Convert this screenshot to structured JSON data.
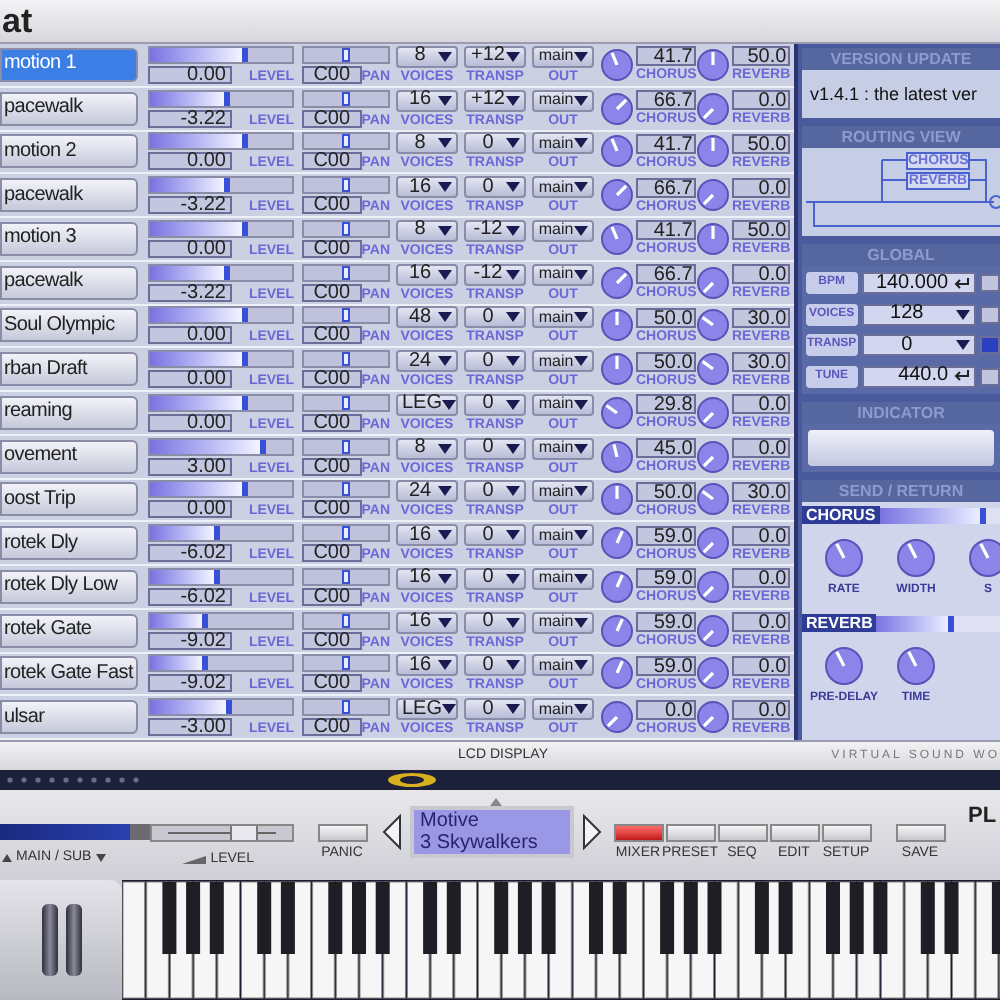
{
  "window": {
    "title": "at"
  },
  "channels": [
    {
      "name": "motion 1",
      "selected": true,
      "volume": {
        "reading": "0.00",
        "level": 0.69
      },
      "pan": {
        "reading": "C00",
        "level": 0.5
      },
      "voices": "8",
      "transp": "+12",
      "out": "main",
      "chorus": {
        "reading": "41.7"
      },
      "reverb": {
        "reading": "50.0"
      },
      "labels": [
        "LEVEL",
        "PAN",
        "VOICES",
        "TRANSP",
        "OUT",
        "CHORUS",
        "REVERB"
      ]
    },
    {
      "name": "pacewalk",
      "selected": false,
      "volume": {
        "reading": "-3.22",
        "level": 0.56
      },
      "pan": {
        "reading": "C00",
        "level": 0.5
      },
      "voices": "16",
      "transp": "+12",
      "out": "main",
      "chorus": {
        "reading": "66.7"
      },
      "reverb": {
        "reading": "0.0"
      },
      "labels": [
        "LEVEL",
        "PAN",
        "VOICES",
        "TRANSP",
        "OUT",
        "CHORUS",
        "REVERB"
      ]
    },
    {
      "name": "motion 2",
      "selected": false,
      "volume": {
        "reading": "0.00",
        "level": 0.69
      },
      "pan": {
        "reading": "C00",
        "level": 0.5
      },
      "voices": "8",
      "transp": "0",
      "out": "main",
      "chorus": {
        "reading": "41.7"
      },
      "reverb": {
        "reading": "50.0"
      },
      "labels": [
        "LEVEL",
        "PAN",
        "VOICES",
        "TRANSP",
        "OUT",
        "CHORUS",
        "REVERB"
      ]
    },
    {
      "name": "pacewalk",
      "selected": false,
      "volume": {
        "reading": "-3.22",
        "level": 0.56
      },
      "pan": {
        "reading": "C00",
        "level": 0.5
      },
      "voices": "16",
      "transp": "0",
      "out": "main",
      "chorus": {
        "reading": "66.7"
      },
      "reverb": {
        "reading": "0.0"
      },
      "labels": [
        "LEVEL",
        "PAN",
        "VOICES",
        "TRANSP",
        "OUT",
        "CHORUS",
        "REVERB"
      ]
    },
    {
      "name": "motion 3",
      "selected": false,
      "volume": {
        "reading": "0.00",
        "level": 0.69
      },
      "pan": {
        "reading": "C00",
        "level": 0.5
      },
      "voices": "8",
      "transp": "-12",
      "out": "main",
      "chorus": {
        "reading": "41.7"
      },
      "reverb": {
        "reading": "50.0"
      },
      "labels": [
        "LEVEL",
        "PAN",
        "VOICES",
        "TRANSP",
        "OUT",
        "CHORUS",
        "REVERB"
      ]
    },
    {
      "name": "pacewalk",
      "selected": false,
      "volume": {
        "reading": "-3.22",
        "level": 0.56
      },
      "pan": {
        "reading": "C00",
        "level": 0.5
      },
      "voices": "16",
      "transp": "-12",
      "out": "main",
      "chorus": {
        "reading": "66.7"
      },
      "reverb": {
        "reading": "0.0"
      },
      "labels": [
        "LEVEL",
        "PAN",
        "VOICES",
        "TRANSP",
        "OUT",
        "CHORUS",
        "REVERB"
      ]
    },
    {
      "name": "Soul Olympic",
      "selected": false,
      "volume": {
        "reading": "0.00",
        "level": 0.69
      },
      "pan": {
        "reading": "C00",
        "level": 0.5
      },
      "voices": "48",
      "transp": "0",
      "out": "main",
      "chorus": {
        "reading": "50.0"
      },
      "reverb": {
        "reading": "30.0"
      },
      "labels": [
        "LEVEL",
        "PAN",
        "VOICES",
        "TRANSP",
        "OUT",
        "CHORUS",
        "REVERB"
      ]
    },
    {
      "name": "rban Draft",
      "selected": false,
      "volume": {
        "reading": "0.00",
        "level": 0.69
      },
      "pan": {
        "reading": "C00",
        "level": 0.5
      },
      "voices": "24",
      "transp": "0",
      "out": "main",
      "chorus": {
        "reading": "50.0"
      },
      "reverb": {
        "reading": "30.0"
      },
      "labels": [
        "LEVEL",
        "PAN",
        "VOICES",
        "TRANSP",
        "OUT",
        "CHORUS",
        "REVERB"
      ]
    },
    {
      "name": "reaming",
      "selected": false,
      "volume": {
        "reading": "0.00",
        "level": 0.69
      },
      "pan": {
        "reading": "C00",
        "level": 0.5
      },
      "voices": "LEG",
      "transp": "0",
      "out": "main",
      "chorus": {
        "reading": "29.8"
      },
      "reverb": {
        "reading": "0.0"
      },
      "labels": [
        "LEVEL",
        "PAN",
        "VOICES",
        "TRANSP",
        "OUT",
        "CHORUS",
        "REVERB"
      ]
    },
    {
      "name": "ovement",
      "selected": false,
      "volume": {
        "reading": "3.00",
        "level": 0.82
      },
      "pan": {
        "reading": "C00",
        "level": 0.5
      },
      "voices": "8",
      "transp": "0",
      "out": "main",
      "chorus": {
        "reading": "45.0"
      },
      "reverb": {
        "reading": "0.0"
      },
      "labels": [
        "LEVEL",
        "PAN",
        "VOICES",
        "TRANSP",
        "OUT",
        "CHORUS",
        "REVERB"
      ]
    },
    {
      "name": "oost Trip",
      "selected": false,
      "volume": {
        "reading": "0.00",
        "level": 0.69
      },
      "pan": {
        "reading": "C00",
        "level": 0.5
      },
      "voices": "24",
      "transp": "0",
      "out": "main",
      "chorus": {
        "reading": "50.0"
      },
      "reverb": {
        "reading": "30.0"
      },
      "labels": [
        "LEVEL",
        "PAN",
        "VOICES",
        "TRANSP",
        "OUT",
        "CHORUS",
        "REVERB"
      ]
    },
    {
      "name": "rotek Dly",
      "selected": false,
      "volume": {
        "reading": "-6.02",
        "level": 0.49
      },
      "pan": {
        "reading": "C00",
        "level": 0.5
      },
      "voices": "16",
      "transp": "0",
      "out": "main",
      "chorus": {
        "reading": "59.0"
      },
      "reverb": {
        "reading": "0.0"
      },
      "labels": [
        "LEVEL",
        "PAN",
        "VOICES",
        "TRANSP",
        "OUT",
        "CHORUS",
        "REVERB"
      ]
    },
    {
      "name": "rotek Dly Low",
      "selected": false,
      "volume": {
        "reading": "-6.02",
        "level": 0.49
      },
      "pan": {
        "reading": "C00",
        "level": 0.5
      },
      "voices": "16",
      "transp": "0",
      "out": "main",
      "chorus": {
        "reading": "59.0"
      },
      "reverb": {
        "reading": "0.0"
      },
      "labels": [
        "LEVEL",
        "PAN",
        "VOICES",
        "TRANSP",
        "OUT",
        "CHORUS",
        "REVERB"
      ]
    },
    {
      "name": "rotek Gate",
      "selected": false,
      "volume": {
        "reading": "-9.02",
        "level": 0.41
      },
      "pan": {
        "reading": "C00",
        "level": 0.5
      },
      "voices": "16",
      "transp": "0",
      "out": "main",
      "chorus": {
        "reading": "59.0"
      },
      "reverb": {
        "reading": "0.0"
      },
      "labels": [
        "LEVEL",
        "PAN",
        "VOICES",
        "TRANSP",
        "OUT",
        "CHORUS",
        "REVERB"
      ]
    },
    {
      "name": "rotek Gate Fast",
      "selected": false,
      "volume": {
        "reading": "-9.02",
        "level": 0.41
      },
      "pan": {
        "reading": "C00",
        "level": 0.5
      },
      "voices": "16",
      "transp": "0",
      "out": "main",
      "chorus": {
        "reading": "59.0"
      },
      "reverb": {
        "reading": "0.0"
      },
      "labels": [
        "LEVEL",
        "PAN",
        "VOICES",
        "TRANSP",
        "OUT",
        "CHORUS",
        "REVERB"
      ]
    },
    {
      "name": "ulsar",
      "selected": false,
      "volume": {
        "reading": "-3.00",
        "level": 0.58
      },
      "pan": {
        "reading": "C00",
        "level": 0.5
      },
      "voices": "LEG",
      "transp": "0",
      "out": "main",
      "chorus": {
        "reading": "0.0"
      },
      "reverb": {
        "reading": "0.0"
      },
      "labels": [
        "LEVEL",
        "PAN",
        "VOICES",
        "TRANSP",
        "OUT",
        "CHORUS",
        "REVERB"
      ]
    }
  ],
  "version_update": {
    "header": "VERSION UPDATE",
    "text": "v1.4.1 : the latest ver"
  },
  "routing_view": {
    "header": "ROUTING VIEW",
    "boxes": [
      "CHORUS",
      "REVERB"
    ]
  },
  "global": {
    "header": "GLOBAL",
    "rows": [
      {
        "kind": "enter",
        "label": "BPM",
        "value": "140.000"
      },
      {
        "kind": "dropdown",
        "label": "VOICES",
        "value": "128"
      },
      {
        "kind": "dropdown",
        "label": "TRANSP",
        "value": "0"
      },
      {
        "kind": "enter",
        "label": "TUNE",
        "value": "440.0"
      }
    ]
  },
  "indicator": {
    "header": "INDICATOR"
  },
  "send_return": {
    "header": "SEND / RETURN",
    "sections": [
      {
        "label": "CHORUS",
        "level": 0.88,
        "knobs": [
          {
            "label": "RATE"
          },
          {
            "label": "WIDTH"
          },
          {
            "label": "S"
          }
        ]
      },
      {
        "label": "REVERB",
        "level": 0.62,
        "knobs": [
          {
            "label": "PRE-DELAY"
          },
          {
            "label": "TIME"
          }
        ]
      }
    ]
  },
  "lcd_bar": {
    "label": "LCD DISPLAY",
    "brand": "VIRTUAL SOUND WO"
  },
  "controls": {
    "output": "MAIN / SUB",
    "level_label": "LEVEL",
    "level": 0.65,
    "panic": "PANIC",
    "lcd_lines": [
      "Motive",
      "3 Skywalkers"
    ],
    "modes": [
      {
        "label": "MIXER",
        "selected": true
      },
      {
        "label": "PRESET",
        "selected": false
      },
      {
        "label": "SEQ",
        "selected": false
      },
      {
        "label": "EDIT",
        "selected": false
      },
      {
        "label": "SETUP",
        "selected": false
      }
    ],
    "save": "SAVE",
    "logo": "PL"
  }
}
